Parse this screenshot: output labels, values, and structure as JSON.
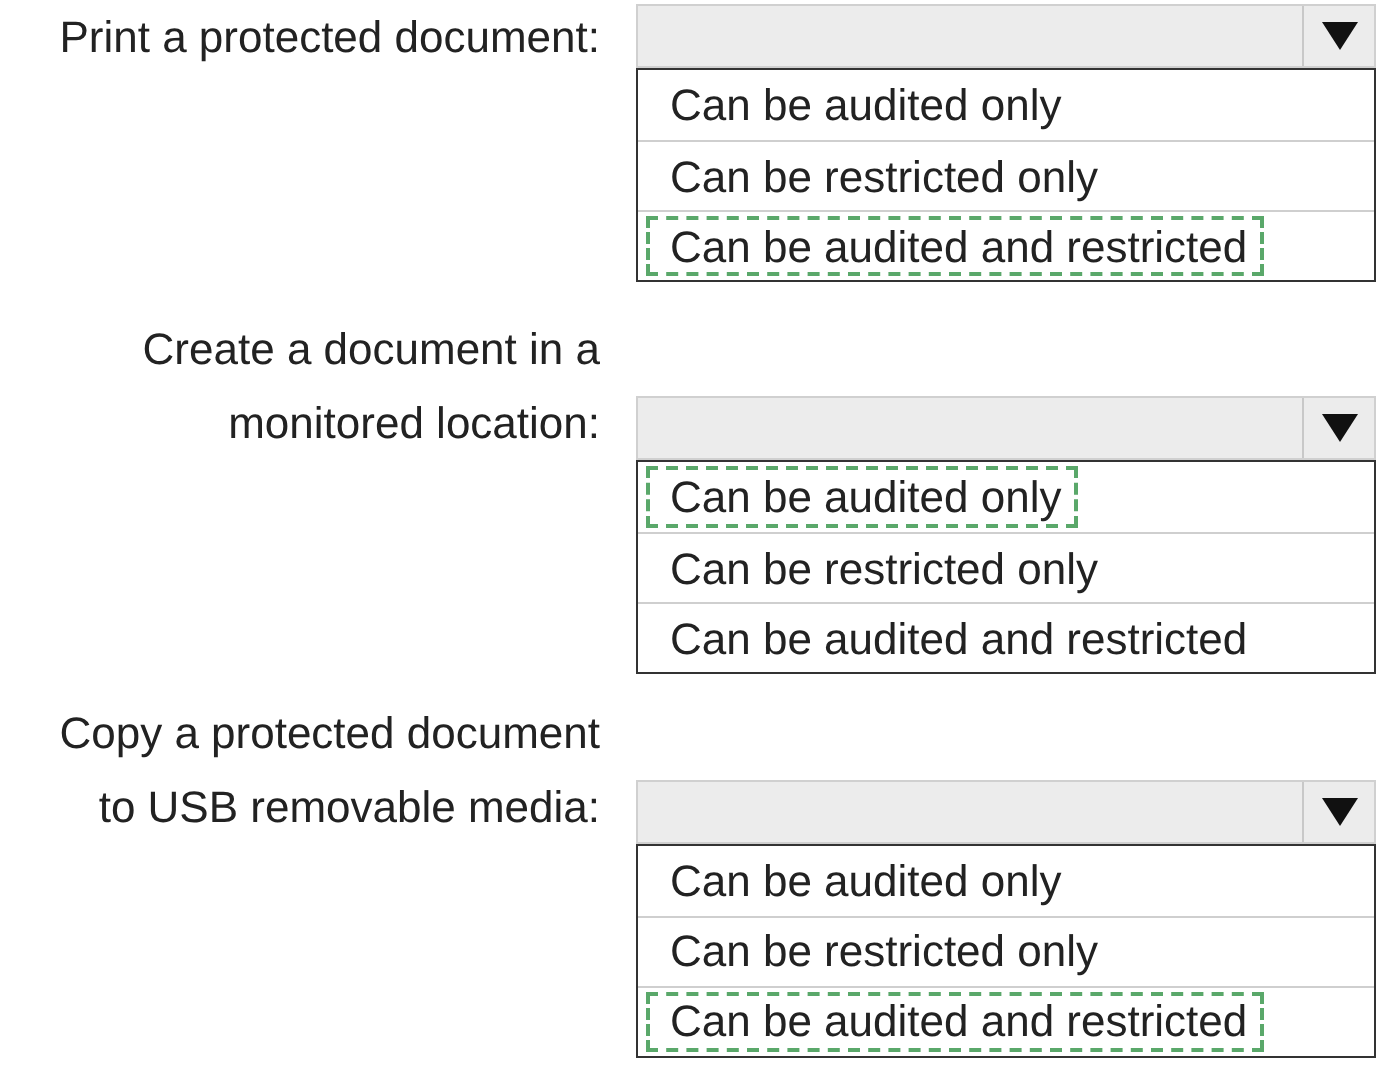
{
  "questions": [
    {
      "label_lines": [
        "Print a protected document:"
      ],
      "options": [
        {
          "text": "Can be audited only",
          "selected": false
        },
        {
          "text": "Can be restricted only",
          "selected": false
        },
        {
          "text": "Can be audited and restricted",
          "selected": true
        }
      ]
    },
    {
      "label_lines": [
        "Create a document in a",
        "monitored location:"
      ],
      "options": [
        {
          "text": "Can be audited only",
          "selected": true
        },
        {
          "text": "Can be restricted only",
          "selected": false
        },
        {
          "text": "Can be audited and restricted",
          "selected": false
        }
      ]
    },
    {
      "label_lines": [
        "Copy a protected document",
        "to USB removable media:"
      ],
      "options": [
        {
          "text": "Can be audited only",
          "selected": false
        },
        {
          "text": "Can be restricted only",
          "selected": false
        },
        {
          "text": "Can be audited and restricted",
          "selected": true
        }
      ]
    }
  ]
}
